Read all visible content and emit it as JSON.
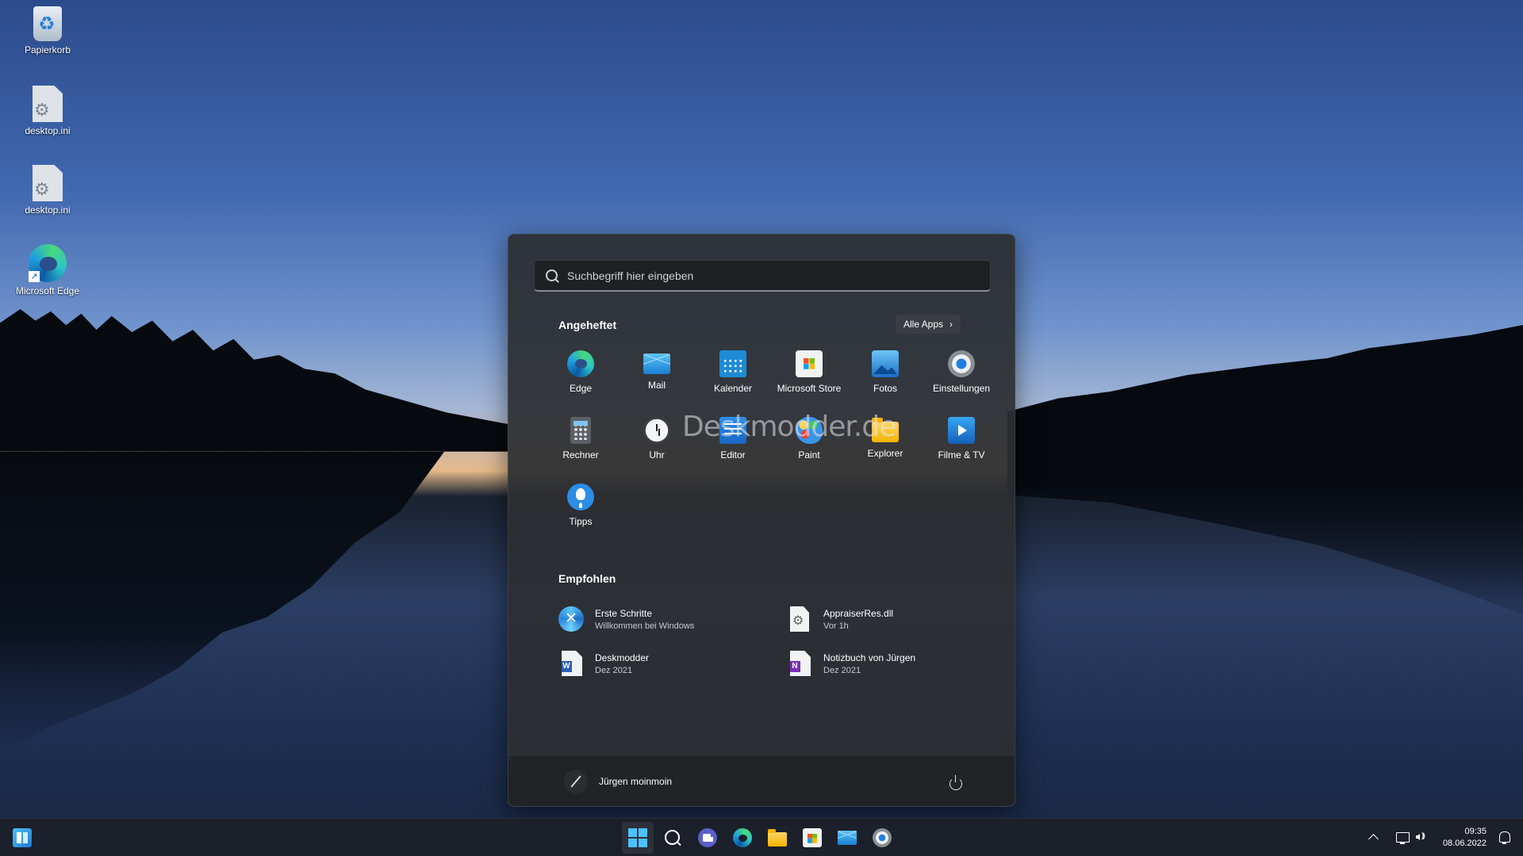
{
  "desktop": {
    "icons": [
      {
        "label": "Papierkorb",
        "icon": "recycle-bin-icon"
      },
      {
        "label": "desktop.ini",
        "icon": "settings-file-icon"
      },
      {
        "label": "desktop.ini",
        "icon": "settings-file-icon"
      },
      {
        "label": "Microsoft Edge",
        "icon": "edge-icon"
      }
    ]
  },
  "start": {
    "search_placeholder": "Suchbegriff hier eingeben",
    "pinned_title": "Angeheftet",
    "all_apps_label": "Alle Apps",
    "pinned": [
      {
        "label": "Edge",
        "icon": "edge-icon"
      },
      {
        "label": "Mail",
        "icon": "mail-icon"
      },
      {
        "label": "Kalender",
        "icon": "calendar-icon"
      },
      {
        "label": "Microsoft Store",
        "icon": "store-icon"
      },
      {
        "label": "Fotos",
        "icon": "photos-icon"
      },
      {
        "label": "Einstellungen",
        "icon": "settings-icon"
      },
      {
        "label": "Rechner",
        "icon": "calculator-icon"
      },
      {
        "label": "Uhr",
        "icon": "clock-icon"
      },
      {
        "label": "Editor",
        "icon": "notepad-icon"
      },
      {
        "label": "Paint",
        "icon": "paint-icon"
      },
      {
        "label": "Explorer",
        "icon": "folder-icon"
      },
      {
        "label": "Filme & TV",
        "icon": "films-icon"
      },
      {
        "label": "Tipps",
        "icon": "tips-icon"
      }
    ],
    "recommended_title": "Empfohlen",
    "recommended": [
      {
        "title": "Erste Schritte",
        "subtitle": "Willkommen bei Windows",
        "icon": "get-started-icon"
      },
      {
        "title": "AppraiserRes.dll",
        "subtitle": "Vor 1h",
        "icon": "dll-file-icon"
      },
      {
        "title": "Deskmodder",
        "subtitle": "Dez 2021",
        "icon": "word-doc-icon"
      },
      {
        "title": "Notizbuch von Jürgen",
        "subtitle": "Dez 2021",
        "icon": "onenote-icon"
      }
    ],
    "user_name": "Jürgen moinmoin",
    "watermark": "Deskmodder.de"
  },
  "taskbar": {
    "apps": [
      "start-icon",
      "search-icon",
      "chat-icon",
      "edge-icon",
      "folder-icon",
      "store-icon",
      "mail-icon",
      "settings-icon"
    ],
    "time": "09:35",
    "date": "08.06.2022"
  }
}
